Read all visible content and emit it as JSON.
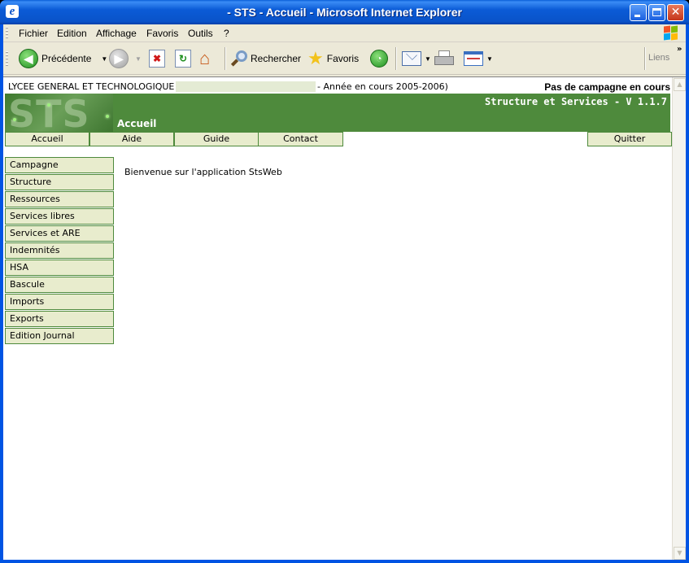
{
  "window": {
    "title": " - STS - Accueil - Microsoft Internet Explorer",
    "icon": "ie-icon",
    "controls": [
      "minimize-icon",
      "maximize-icon",
      "close-icon"
    ]
  },
  "menubar": {
    "items": [
      "Fichier",
      "Edition",
      "Affichage",
      "Favoris",
      "Outils",
      "?"
    ]
  },
  "toolbar": {
    "back_label": "Précédente",
    "search_label": "Rechercher",
    "favorites_label": "Favoris",
    "links_label": "Liens",
    "chevron": "»"
  },
  "page": {
    "etablissement": "LYCEE GENERAL ET TECHNOLOGIQUE",
    "annee": "- Année en cours 2005-2006)",
    "campagne_status": "Pas de campagne en cours",
    "logo_text": "STS",
    "version": "Structure et Services - V 1.1.7",
    "section_title": "Accueil",
    "nav_tabs": [
      "Accueil",
      "Aide",
      "Guide",
      "Contact"
    ],
    "quit_label": "Quitter",
    "side_menu": [
      "Campagne",
      "Structure",
      "Ressources",
      "Services libres",
      "Services et ARE",
      "Indemnités",
      "HSA",
      "Bascule",
      "Imports",
      "Exports",
      "Edition Journal"
    ],
    "welcome_text": "Bienvenue sur l'application StsWeb"
  },
  "colors": {
    "banner_green": "#4e8a3c",
    "menu_bg": "#e8eccd",
    "xp_title_blue": "#0a53c9"
  }
}
